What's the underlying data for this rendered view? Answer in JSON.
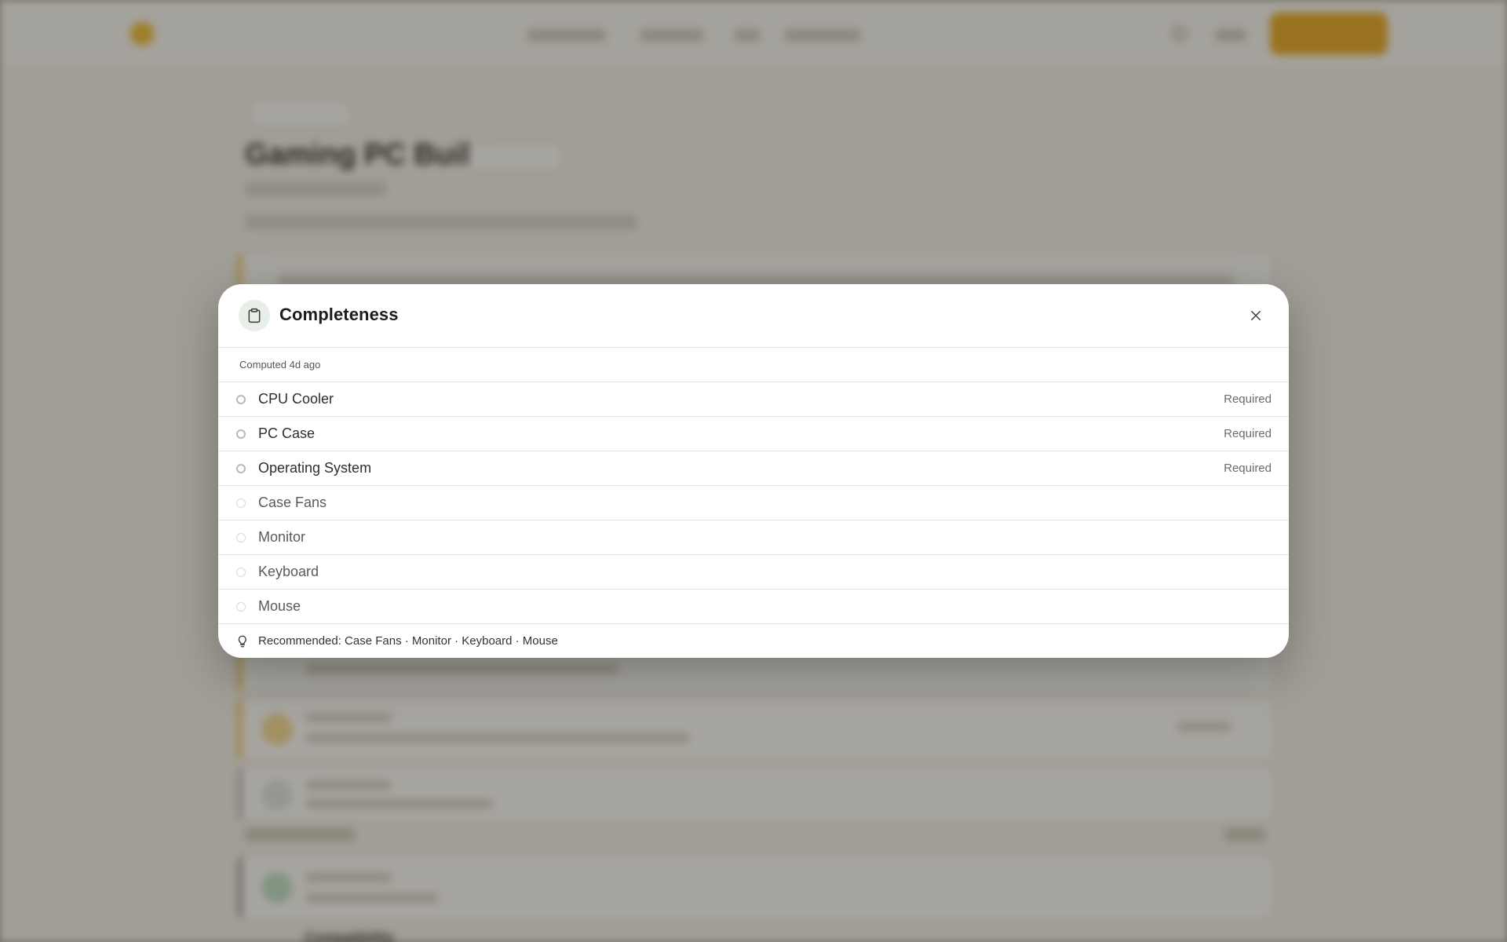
{
  "modal": {
    "title": "Completeness",
    "header_icon": "clipboard-icon",
    "close_icon": "close-icon",
    "computed": "Computed 4d ago",
    "items": [
      {
        "label": "CPU Cooler",
        "status": "Required"
      },
      {
        "label": "PC Case",
        "status": "Required"
      },
      {
        "label": "Operating System",
        "status": "Required"
      },
      {
        "label": "Case Fans",
        "status": ""
      },
      {
        "label": "Monitor",
        "status": ""
      },
      {
        "label": "Keyboard",
        "status": ""
      },
      {
        "label": "Mouse",
        "status": ""
      }
    ],
    "recommendation_icon": "lightbulb-icon",
    "recommendation": "Recommended: Case Fans · Monitor · Keyboard · Mouse"
  },
  "background": {
    "title": "Gaming PC Build",
    "last_section": "Compatibility",
    "colors": {
      "accent": "#e8a417",
      "brand": "#f1b82c",
      "success": "#3c9a5f"
    }
  }
}
